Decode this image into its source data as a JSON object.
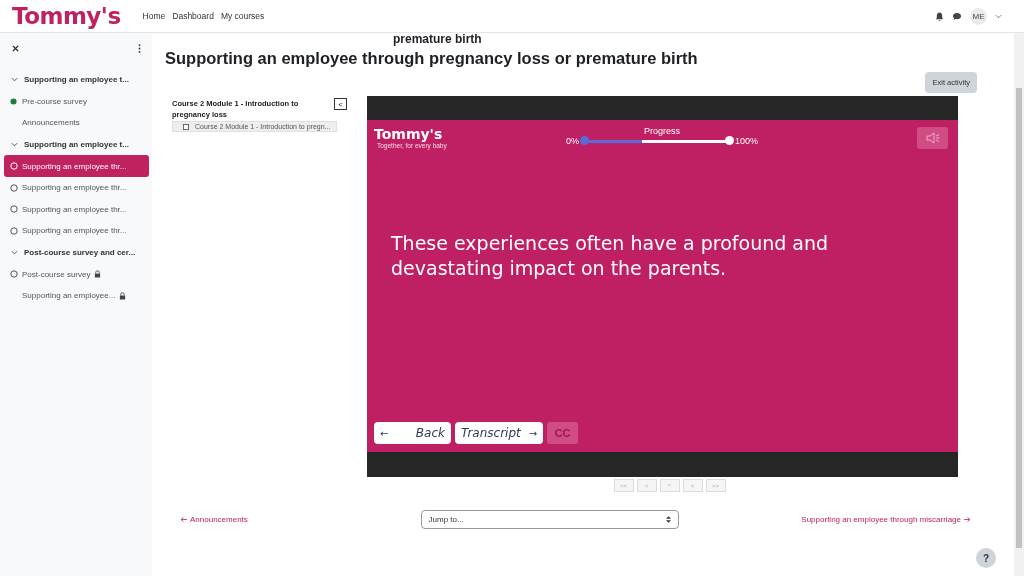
{
  "header": {
    "logo": "Tommy's",
    "nav": [
      "Home",
      "Dashboard",
      "My courses"
    ],
    "avatar": "ME"
  },
  "sidebar": {
    "sections": [
      {
        "title": "Supporting an employee t...",
        "expanded": true,
        "items": [
          {
            "label": "Pre-course survey",
            "tracked": true,
            "completed": true,
            "locked": false,
            "selected": false
          },
          {
            "label": "Announcements",
            "tracked": false,
            "completed": false,
            "locked": false,
            "selected": false
          }
        ]
      },
      {
        "title": "Supporting an employee t...",
        "expanded": true,
        "items": [
          {
            "label": "Supporting an employee thr...",
            "tracked": true,
            "completed": false,
            "locked": false,
            "selected": true
          },
          {
            "label": "Supporting an employee thr...",
            "tracked": true,
            "completed": false,
            "locked": false,
            "selected": false
          },
          {
            "label": "Supporting an employee thr...",
            "tracked": true,
            "completed": false,
            "locked": false,
            "selected": false
          },
          {
            "label": "Supporting an employee thr...",
            "tracked": true,
            "completed": false,
            "locked": false,
            "selected": false
          }
        ]
      },
      {
        "title": "Post-course survey and cer...",
        "expanded": true,
        "items": [
          {
            "label": "Post-course survey",
            "tracked": true,
            "completed": false,
            "locked": true,
            "selected": false
          },
          {
            "label": "Supporting an employee...",
            "tracked": false,
            "completed": false,
            "locked": true,
            "selected": false
          }
        ]
      }
    ]
  },
  "page": {
    "overflow_title": "premature birth",
    "title": "Supporting an employee through pregnancy loss or premature birth",
    "exit_button": "Exit activity"
  },
  "toc": {
    "title": "Course 2 Module 1 - Introduction to pregnancy loss",
    "collapse_button": "<",
    "item": "Course 2 Module 1 - Introduction to pregn..."
  },
  "player": {
    "logo": "Tommy's",
    "tagline": "Together, for every baby",
    "progress": {
      "label": "Progress",
      "min": "0%",
      "max": "100%",
      "level": 0.4
    },
    "slide_text": "These experiences often have a profound and devastating impact on the parents.",
    "back_button": "Back",
    "transcript_button": "Transcript",
    "cc_button": "CC",
    "back_arrow": "←",
    "transcript_arrow": "→"
  },
  "pager": [
    "<<",
    "<",
    "^",
    ">",
    ">>"
  ],
  "footer": {
    "prev_link": "Announcements",
    "jump_placeholder": "Jump to...",
    "next_link": "Supporting an employee through miscarriage",
    "help": "?"
  }
}
